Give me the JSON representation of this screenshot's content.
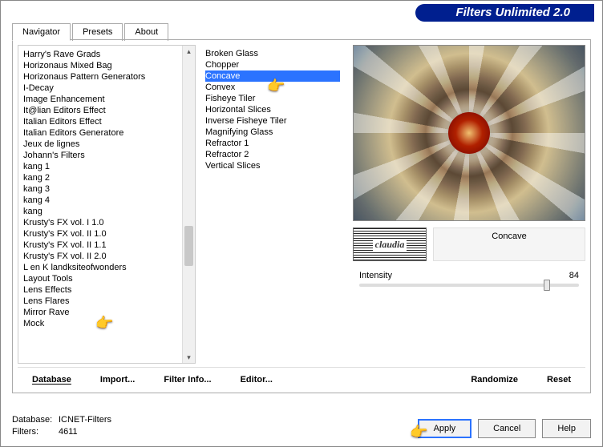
{
  "app": {
    "title": "Filters Unlimited 2.0"
  },
  "tabs": [
    "Navigator",
    "Presets",
    "About"
  ],
  "categories": [
    "Harry's Rave Grads",
    "Horizonaus Mixed Bag",
    "Horizonaus Pattern Generators",
    "I-Decay",
    "Image Enhancement",
    "It@lian Editors Effect",
    "Italian Editors Effect",
    "Italian Editors Generatore",
    "Jeux de lignes",
    "Johann's Filters",
    "kang 1",
    "kang 2",
    "kang 3",
    "kang 4",
    "kang",
    "Krusty's FX vol. I 1.0",
    "Krusty's FX vol. II 1.0",
    "Krusty's FX vol. II 1.1",
    "Krusty's FX vol. II 2.0",
    "L en K landksiteofwonders",
    "Layout Tools",
    "Lens Effects",
    "Lens Flares",
    "Mirror Rave",
    "Mock"
  ],
  "filters": [
    "Broken Glass",
    "Chopper",
    "Concave",
    "Convex",
    "Fisheye Tiler",
    "Horizontal Slices",
    "Inverse Fisheye Tiler",
    "Magnifying Glass",
    "Refractor 1",
    "Refractor 2",
    "Vertical Slices"
  ],
  "selected_filter": "Concave",
  "watermark": "claudia",
  "param": {
    "label": "Intensity",
    "value": "84"
  },
  "buttons": {
    "database": "Database",
    "import": "Import...",
    "filter_info": "Filter Info...",
    "editor": "Editor...",
    "randomize": "Randomize",
    "reset": "Reset",
    "apply": "Apply",
    "cancel": "Cancel",
    "help": "Help"
  },
  "status": {
    "db_label": "Database:",
    "db_value": "ICNET-Filters",
    "filters_label": "Filters:",
    "filters_value": "4611"
  }
}
